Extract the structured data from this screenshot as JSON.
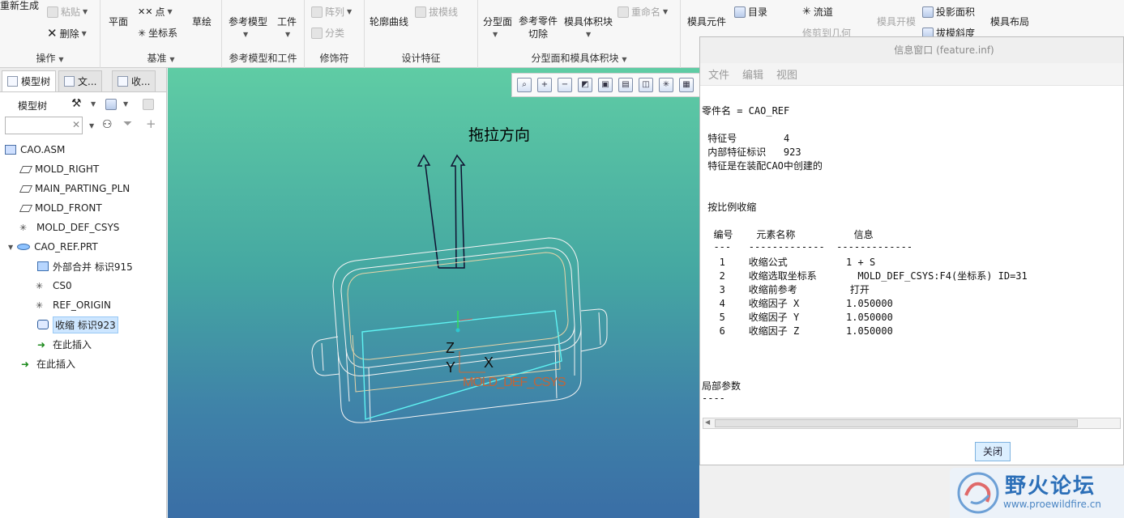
{
  "ribbon": {
    "groups": [
      {
        "label": "操作",
        "buttons": [
          "重新生成",
          "粘贴",
          "删除"
        ]
      },
      {
        "label": "基准",
        "buttons": [
          "平面",
          "点",
          "坐标系",
          "草绘"
        ]
      },
      {
        "label": "参考模型和工件",
        "buttons": [
          "参考模型",
          "工件"
        ]
      },
      {
        "label": "修饰符",
        "buttons": [
          "阵列",
          "分类"
        ]
      },
      {
        "label": "设计特征",
        "buttons": [
          "轮廓曲线",
          "拔模线"
        ]
      },
      {
        "label": "分型面和模具体积块",
        "buttons": [
          "分型面",
          "参考零件切除",
          "模具体积块",
          "重命名"
        ]
      },
      {
        "label": "",
        "buttons": [
          "模具元件",
          "目录",
          "流道",
          "修剪到几何",
          "模具开模",
          "投影面积",
          "拔模斜度",
          "模具布局"
        ]
      }
    ]
  },
  "left_panel": {
    "tabs": [
      "模型树",
      "文...",
      "收..."
    ],
    "toolbar_label": "模型树",
    "search_placeholder": "",
    "tree": [
      {
        "label": "CAO.ASM",
        "icon": "assembly-icon"
      },
      {
        "label": "MOLD_RIGHT",
        "icon": "datum-plane-icon"
      },
      {
        "label": "MAIN_PARTING_PLN",
        "icon": "datum-plane-icon"
      },
      {
        "label": "MOLD_FRONT",
        "icon": "datum-plane-icon"
      },
      {
        "label": "MOLD_DEF_CSYS",
        "icon": "csys-icon"
      },
      {
        "label": "CAO_REF.PRT",
        "icon": "part-icon"
      },
      {
        "label": "外部合并 标识915",
        "icon": "merge-icon"
      },
      {
        "label": "CS0",
        "icon": "csys-icon"
      },
      {
        "label": "REF_ORIGIN",
        "icon": "csys-icon"
      },
      {
        "label": "收缩 标识923",
        "icon": "shrink-icon"
      },
      {
        "label": "在此插入",
        "icon": "insert-here-icon"
      },
      {
        "label": "在此插入",
        "icon": "insert-here-icon"
      }
    ]
  },
  "viewport": {
    "pull_direction_label": "拖拉方向",
    "axis_labels": {
      "z": "Z",
      "y": "Y",
      "x": "X"
    },
    "csys_text": "MOLD_DEF_CSYS"
  },
  "info_window": {
    "title": "信息窗口 (feature.inf)",
    "menu": [
      "文件",
      "编辑",
      "视图"
    ],
    "lines": [
      "零件名 = CAO_REF",
      "",
      " 特征号        4",
      " 内部特征标识   923",
      " 特征是在装配CAO中创建的",
      "",
      "",
      " 按比例收缩",
      "",
      "  编号    元素名称          信息",
      "  ---   -------------  -------------",
      "   1    收缩公式          1 + S",
      "   2    收缩选取坐标系       MOLD_DEF_CSYS:F4(坐标系) ID=31",
      "   3    收缩前参考         打开",
      "   4    收缩因子 X        1.050000",
      "   5    收缩因子 Y        1.050000",
      "   6    收缩因子 Z        1.050000",
      "",
      "",
      "",
      "局部参数",
      "----"
    ],
    "close_label": "关闭"
  },
  "watermark": {
    "title": "野火论坛",
    "url": "www.proewildfire.cn"
  }
}
